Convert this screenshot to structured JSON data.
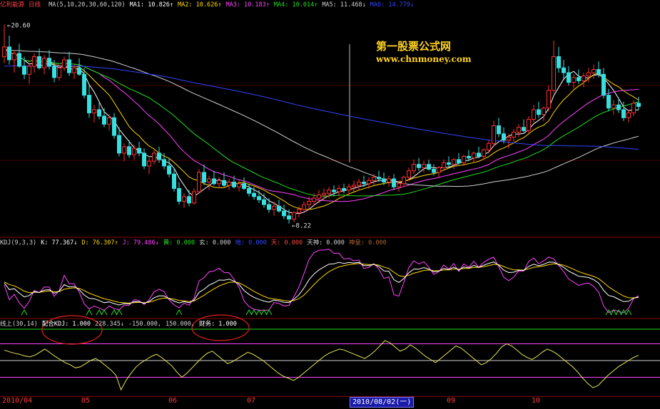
{
  "stock": {
    "name": "亿利能源",
    "period": "日线"
  },
  "price_header": [
    {
      "label": "MA(5,10,20,30,60,120)",
      "value": "",
      "arrow": "",
      "color": "#d0d0d0"
    },
    {
      "label": "MA1:",
      "value": "10.826",
      "arrow": "↑",
      "color": "#ffffff"
    },
    {
      "label": "MA2:",
      "value": "10.626",
      "arrow": "↑",
      "color": "#ffd700"
    },
    {
      "label": "MA3:",
      "value": "10.183",
      "arrow": "↑",
      "color": "#ff44ff"
    },
    {
      "label": "MA4:",
      "value": "10.014",
      "arrow": "↑",
      "color": "#22dd22"
    },
    {
      "label": "MA5:",
      "value": "11.468",
      "arrow": "↓",
      "color": "#d0d0d0"
    },
    {
      "label": "MA6:",
      "value": "14.779",
      "arrow": "↓",
      "color": "#3344ff"
    }
  ],
  "price_marks": {
    "high": "20.60",
    "low": "8.22"
  },
  "kdj_header": [
    {
      "label": "KDJ(9,3,3)",
      "value": "",
      "arrow": "",
      "color": "#d0d0d0"
    },
    {
      "label": "K:",
      "value": "77.367",
      "arrow": "↓",
      "color": "#ffffff"
    },
    {
      "label": "D:",
      "value": "76.307",
      "arrow": "↑",
      "color": "#ffd700"
    },
    {
      "label": "J:",
      "value": "79.486",
      "arrow": "↓",
      "color": "#ff44ff"
    },
    {
      "label": "黄:",
      "value": "0.000",
      "arrow": "",
      "color": "#22dd22"
    },
    {
      "label": "玄:",
      "value": "0.000",
      "arrow": "",
      "color": "#d0d0d0"
    },
    {
      "label": "地:",
      "value": "0.000",
      "arrow": "",
      "color": "#3344ff"
    },
    {
      "label": "天:",
      "value": "0.000",
      "arrow": "",
      "color": "#ff4444"
    },
    {
      "label": "天神:",
      "value": "0.000",
      "arrow": "",
      "color": "#d0d0d0"
    },
    {
      "label": "神皇:",
      "value": "0.000",
      "arrow": "",
      "color": "#aa6633"
    }
  ],
  "line_header": [
    {
      "label": "线上(30,14)",
      "value": "",
      "arrow": "",
      "color": "#d0d0d0"
    },
    {
      "label": "配合KDJ:",
      "value": "1.000",
      "arrow": "",
      "color": "#ffffff"
    },
    {
      "label": "",
      "value": "228.345",
      "arrow": "↓",
      "color": "#d0d0d0"
    },
    {
      "label": "",
      "value": "-150.000,",
      "arrow": "",
      "color": "#d0d0d0"
    },
    {
      "label": "",
      "value": "150.000,",
      "arrow": "",
      "color": "#d0d0d0"
    },
    {
      "label": "财务:",
      "value": "1.000",
      "arrow": "",
      "color": "#ffffff"
    }
  ],
  "watermark": {
    "line1": "第一股票公式网",
    "line2": "www.chnmoney.com"
  },
  "date_axis": {
    "months": [
      "2010/04",
      "05",
      "06",
      "07",
      "09",
      "10"
    ],
    "cursor_date": "2010/08/02(一)"
  },
  "chart_data": {
    "type": "candlestick",
    "title": "亿利能源 日线",
    "price_axis": {
      "ylim": [
        7.5,
        21.5
      ]
    },
    "kdj_axis": {
      "ylim": [
        -10,
        110
      ]
    },
    "line_axis": {
      "ylim": [
        -150,
        150
      ]
    },
    "candles": [
      [
        18.6,
        20.6,
        18.2,
        19.2
      ],
      [
        19.2,
        19.9,
        18.1,
        18.4
      ],
      [
        18.4,
        19.0,
        17.6,
        18.8
      ],
      [
        18.8,
        19.4,
        17.9,
        18.0
      ],
      [
        18.0,
        18.6,
        17.2,
        17.5
      ],
      [
        17.5,
        18.2,
        16.9,
        18.0
      ],
      [
        18.0,
        18.8,
        17.6,
        18.6
      ],
      [
        18.6,
        19.1,
        17.8,
        17.9
      ],
      [
        17.9,
        18.7,
        17.5,
        18.5
      ],
      [
        18.5,
        19.0,
        17.8,
        18.0
      ],
      [
        18.0,
        18.4,
        17.0,
        17.3
      ],
      [
        17.3,
        18.1,
        17.1,
        17.9
      ],
      [
        17.9,
        18.6,
        17.7,
        18.4
      ],
      [
        18.4,
        18.9,
        17.4,
        17.6
      ],
      [
        17.6,
        18.1,
        17.2,
        17.9
      ],
      [
        17.9,
        18.5,
        17.4,
        17.5
      ],
      [
        17.5,
        17.9,
        16.0,
        16.2
      ],
      [
        16.2,
        16.8,
        14.8,
        15.1
      ],
      [
        15.1,
        15.6,
        14.5,
        15.3
      ],
      [
        15.3,
        15.8,
        14.7,
        14.9
      ],
      [
        14.9,
        15.4,
        14.2,
        14.4
      ],
      [
        14.4,
        15.0,
        14.0,
        14.8
      ],
      [
        14.8,
        15.1,
        13.5,
        13.7
      ],
      [
        13.7,
        14.2,
        12.4,
        12.6
      ],
      [
        12.6,
        13.2,
        12.1,
        13.0
      ],
      [
        13.0,
        13.4,
        12.3,
        12.5
      ],
      [
        12.5,
        13.1,
        12.2,
        12.9
      ],
      [
        12.9,
        13.3,
        12.4,
        12.6
      ],
      [
        12.6,
        12.9,
        11.6,
        11.8
      ],
      [
        11.8,
        12.3,
        11.3,
        12.1
      ],
      [
        12.1,
        12.8,
        11.9,
        12.6
      ],
      [
        12.6,
        13.0,
        12.0,
        12.2
      ],
      [
        12.2,
        12.6,
        11.6,
        11.8
      ],
      [
        11.8,
        12.3,
        11.1,
        11.3
      ],
      [
        11.3,
        11.7,
        10.2,
        10.4
      ],
      [
        10.4,
        10.8,
        9.4,
        9.6
      ],
      [
        9.6,
        10.1,
        9.2,
        9.9
      ],
      [
        9.9,
        10.3,
        9.3,
        9.5
      ],
      [
        9.5,
        10.4,
        9.4,
        10.2
      ],
      [
        10.2,
        11.6,
        10.1,
        11.4
      ],
      [
        11.4,
        11.9,
        10.6,
        10.8
      ],
      [
        10.8,
        11.2,
        10.3,
        11.0
      ],
      [
        11.0,
        11.5,
        10.6,
        10.7
      ],
      [
        10.7,
        11.1,
        10.4,
        10.9
      ],
      [
        10.9,
        11.4,
        10.5,
        10.6
      ],
      [
        10.6,
        11.0,
        10.3,
        10.8
      ],
      [
        10.8,
        11.2,
        10.4,
        10.5
      ],
      [
        10.5,
        10.9,
        10.2,
        10.7
      ],
      [
        10.7,
        11.1,
        10.3,
        10.4
      ],
      [
        10.4,
        10.7,
        9.9,
        10.1
      ],
      [
        10.1,
        10.5,
        9.7,
        9.9
      ],
      [
        9.9,
        10.3,
        9.5,
        9.7
      ],
      [
        9.7,
        10.1,
        9.2,
        9.4
      ],
      [
        9.4,
        9.8,
        8.9,
        9.1
      ],
      [
        9.1,
        9.6,
        8.7,
        9.3
      ],
      [
        9.3,
        9.7,
        8.9,
        9.0
      ],
      [
        9.0,
        9.4,
        8.5,
        8.7
      ],
      [
        8.7,
        9.1,
        8.22,
        8.5
      ],
      [
        8.5,
        9.0,
        8.3,
        8.9
      ],
      [
        8.9,
        9.3,
        8.6,
        9.1
      ],
      [
        9.1,
        9.6,
        8.9,
        9.4
      ],
      [
        9.4,
        9.9,
        9.1,
        9.6
      ],
      [
        9.6,
        10.1,
        9.3,
        9.8
      ],
      [
        9.8,
        10.3,
        9.5,
        10.0
      ],
      [
        10.0,
        10.4,
        9.7,
        10.1
      ],
      [
        10.1,
        10.5,
        9.8,
        10.3
      ],
      [
        10.3,
        10.6,
        9.9,
        10.2
      ],
      [
        10.2,
        10.6,
        9.9,
        10.4
      ],
      [
        10.4,
        10.7,
        10.1,
        10.3
      ],
      [
        10.3,
        10.7,
        10.0,
        10.5
      ],
      [
        10.5,
        10.9,
        10.2,
        10.6
      ],
      [
        10.6,
        11.0,
        10.3,
        10.8
      ],
      [
        10.8,
        11.2,
        10.5,
        10.7
      ],
      [
        10.7,
        11.1,
        10.4,
        10.9
      ],
      [
        10.9,
        11.3,
        10.6,
        11.1
      ],
      [
        11.1,
        11.5,
        10.8,
        11.0
      ],
      [
        11.0,
        11.4,
        10.6,
        10.8
      ],
      [
        10.8,
        11.2,
        10.5,
        11.0
      ],
      [
        11.0,
        11.3,
        10.3,
        10.5
      ],
      [
        10.5,
        10.9,
        10.2,
        10.7
      ],
      [
        10.7,
        11.2,
        10.5,
        11.1
      ],
      [
        11.1,
        11.7,
        10.9,
        11.5
      ],
      [
        11.5,
        12.2,
        11.3,
        11.9
      ],
      [
        11.9,
        12.3,
        11.5,
        11.7
      ],
      [
        11.7,
        12.1,
        11.4,
        11.9
      ],
      [
        11.9,
        12.2,
        11.5,
        11.6
      ],
      [
        11.6,
        11.9,
        11.2,
        11.4
      ],
      [
        11.4,
        11.8,
        11.1,
        11.7
      ],
      [
        11.7,
        12.2,
        11.5,
        12.0
      ],
      [
        12.0,
        12.4,
        11.7,
        11.9
      ],
      [
        11.9,
        12.3,
        11.6,
        12.2
      ],
      [
        12.2,
        12.6,
        11.9,
        12.0
      ],
      [
        12.0,
        12.5,
        11.8,
        12.4
      ],
      [
        12.4,
        12.8,
        12.1,
        12.3
      ],
      [
        12.3,
        12.7,
        12.0,
        12.6
      ],
      [
        12.6,
        13.0,
        12.3,
        12.4
      ],
      [
        12.4,
        12.9,
        12.2,
        12.8
      ],
      [
        12.8,
        13.4,
        12.6,
        13.2
      ],
      [
        13.2,
        14.6,
        13.0,
        14.3
      ],
      [
        14.3,
        14.8,
        13.6,
        13.8
      ],
      [
        13.8,
        14.2,
        13.2,
        13.4
      ],
      [
        13.4,
        13.8,
        12.9,
        13.6
      ],
      [
        13.6,
        14.1,
        13.3,
        13.9
      ],
      [
        13.9,
        14.4,
        13.6,
        14.2
      ],
      [
        14.2,
        14.7,
        13.9,
        14.0
      ],
      [
        14.0,
        14.9,
        13.8,
        14.7
      ],
      [
        14.7,
        15.6,
        14.5,
        15.3
      ],
      [
        15.3,
        15.8,
        14.8,
        15.0
      ],
      [
        15.0,
        15.5,
        14.6,
        15.4
      ],
      [
        15.4,
        16.8,
        15.2,
        16.5
      ],
      [
        16.5,
        19.6,
        16.3,
        18.6
      ],
      [
        18.6,
        19.2,
        17.6,
        17.9
      ],
      [
        17.9,
        18.4,
        17.2,
        17.6
      ],
      [
        17.6,
        18.0,
        16.8,
        17.0
      ],
      [
        17.0,
        17.5,
        16.6,
        17.3
      ],
      [
        17.3,
        17.8,
        16.9,
        17.1
      ],
      [
        17.1,
        17.6,
        16.7,
        17.4
      ],
      [
        17.4,
        17.9,
        17.0,
        17.6
      ],
      [
        17.6,
        18.1,
        17.2,
        17.8
      ],
      [
        17.8,
        18.3,
        17.3,
        17.5
      ],
      [
        17.5,
        17.9,
        16.0,
        16.2
      ],
      [
        16.2,
        16.6,
        15.2,
        15.4
      ],
      [
        15.4,
        15.9,
        15.0,
        15.6
      ],
      [
        15.6,
        16.0,
        15.1,
        15.3
      ],
      [
        15.3,
        15.8,
        14.6,
        14.8
      ],
      [
        14.8,
        15.3,
        14.5,
        15.1
      ],
      [
        15.1,
        15.9,
        14.9,
        15.7
      ],
      [
        15.7,
        16.1,
        15.3,
        15.5
      ]
    ],
    "ma": [
      {
        "name": "MA1",
        "period": 5,
        "color": "#ffffff"
      },
      {
        "name": "MA2",
        "period": 10,
        "color": "#ffd700"
      },
      {
        "name": "MA3",
        "period": 20,
        "color": "#ff44ff"
      },
      {
        "name": "MA4",
        "period": 30,
        "color": "#22dd22"
      },
      {
        "name": "MA5",
        "period": 60,
        "color": "#d0d0d0"
      },
      {
        "name": "MA6",
        "period": 120,
        "color": "#3344ff"
      }
    ],
    "ma_long_seed": {
      "MA5": 19.0,
      "MA6": 18.0
    },
    "kdj_colors": {
      "K": "#ffffff",
      "D": "#ffd700",
      "J": "#ff44ff"
    },
    "line_indicator_values": [
      50,
      42,
      35,
      30,
      22,
      18,
      25,
      40,
      55,
      38,
      20,
      5,
      -10,
      -20,
      -35,
      -30,
      -15,
      0,
      10,
      -5,
      -25,
      -45,
      -70,
      -140,
      -95,
      -60,
      -30,
      -10,
      5,
      20,
      30,
      15,
      -5,
      -25,
      -55,
      -80,
      -60,
      -35,
      -10,
      15,
      35,
      45,
      25,
      5,
      -15,
      -5,
      10,
      25,
      40,
      30,
      15,
      0,
      -20,
      -40,
      -60,
      -75,
      -85,
      -95,
      -80,
      -60,
      -40,
      -20,
      0,
      20,
      35,
      45,
      55,
      50,
      40,
      30,
      20,
      10,
      25,
      45,
      70,
      95,
      85,
      65,
      45,
      55,
      75,
      60,
      40,
      20,
      5,
      -10,
      10,
      30,
      50,
      70,
      60,
      40,
      20,
      0,
      -20,
      -10,
      10,
      35,
      65,
      80,
      70,
      50,
      30,
      15,
      5,
      20,
      40,
      55,
      45,
      30,
      10,
      -10,
      -30,
      -55,
      -85,
      -110,
      -130,
      -120,
      -95,
      -70,
      -50,
      -30,
      -15,
      0,
      15,
      25
    ],
    "line_levels": [
      {
        "value": 150,
        "color": "#22dd22"
      },
      {
        "value": 80,
        "color": "#ff44ff"
      },
      {
        "value": 0,
        "color": "#d0d0d0"
      },
      {
        "value": -80,
        "color": "#ff44ff"
      }
    ]
  }
}
